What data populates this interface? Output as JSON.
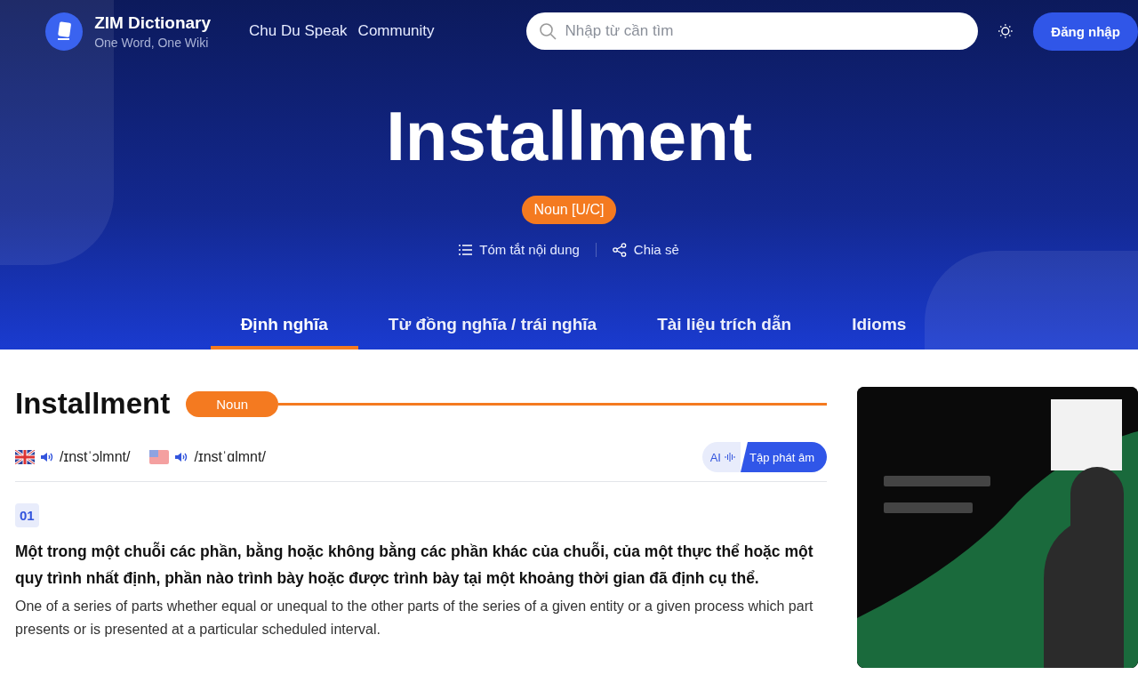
{
  "header": {
    "logo_title": "ZIM Dictionary",
    "logo_subtitle": "One Word, One Wiki",
    "nav": [
      "Chu Du Speak",
      "Community"
    ],
    "search": {
      "placeholder": "Nhập từ cần tìm"
    },
    "login_button": "Đăng nhập"
  },
  "hero": {
    "word": "Installment",
    "pos_badge": "Noun [U/C]",
    "actions": [
      {
        "kind": "summary",
        "label": "Tóm tắt nội dung"
      },
      {
        "kind": "share",
        "label": "Chia sẻ"
      }
    ]
  },
  "tabs": [
    {
      "label": "Định nghĩa",
      "selected": true
    },
    {
      "label": "Từ đồng nghĩa / trái nghĩa",
      "selected": false
    },
    {
      "label": "Tài liệu trích dẫn",
      "selected": false
    },
    {
      "label": "Idioms",
      "selected": false
    }
  ],
  "entry": {
    "word": "Installment",
    "pos": "Noun",
    "pronunciations": [
      {
        "kind": "uk",
        "ipa": "/ɪnstˈɔlmnt/"
      },
      {
        "kind": "us",
        "ipa": "/ɪnstˈɑlmnt/"
      }
    ],
    "practice": {
      "ai_label": "AI",
      "button": "Tập phát âm"
    },
    "senses": [
      {
        "number": "01",
        "definition_vi": "Một trong một chuỗi các phần, bằng hoặc không bằng các phần khác của chuỗi, của một thực thể hoặc một quy trình nhất định, phần nào trình bày hoặc được trình bày tại một khoảng thời gian đã định cụ thể.",
        "definition_en": "One of a series of parts whether equal or unequal to the other parts of the series of a given entity or a given process which part presents or is presented at a particular scheduled interval."
      }
    ]
  }
}
